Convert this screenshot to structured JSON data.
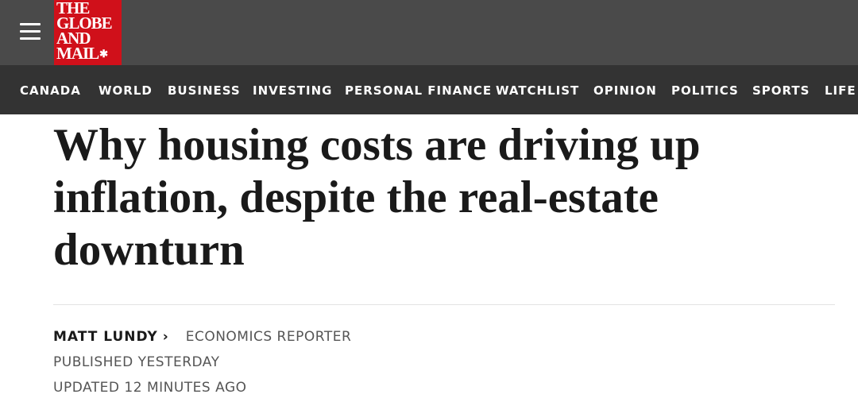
{
  "header": {
    "menu_icon": "hamburger-menu-icon",
    "logo": {
      "lines": [
        "THE",
        "GLOBE",
        "AND",
        "MAIL"
      ],
      "leaf_icon": "maple-leaf-icon",
      "leaf_glyph": "✱",
      "color": "#d0101a"
    }
  },
  "nav": {
    "items": [
      {
        "label": "CANADA"
      },
      {
        "label": "WORLD"
      },
      {
        "label": "BUSINESS"
      },
      {
        "label": "INVESTING"
      },
      {
        "label": "PERSONAL FINANCE"
      },
      {
        "label": "WATCHLIST"
      },
      {
        "label": "OPINION"
      },
      {
        "label": "POLITICS"
      },
      {
        "label": "SPORTS"
      },
      {
        "label": "LIFE"
      }
    ]
  },
  "article": {
    "headline": "Why housing costs are driving up inflation, despite the real-estate downturn",
    "author": "MATT LUNDY",
    "author_chevron": "›",
    "role": "ECONOMICS REPORTER",
    "published": "PUBLISHED YESTERDAY",
    "updated": "UPDATED 12 MINUTES AGO"
  }
}
